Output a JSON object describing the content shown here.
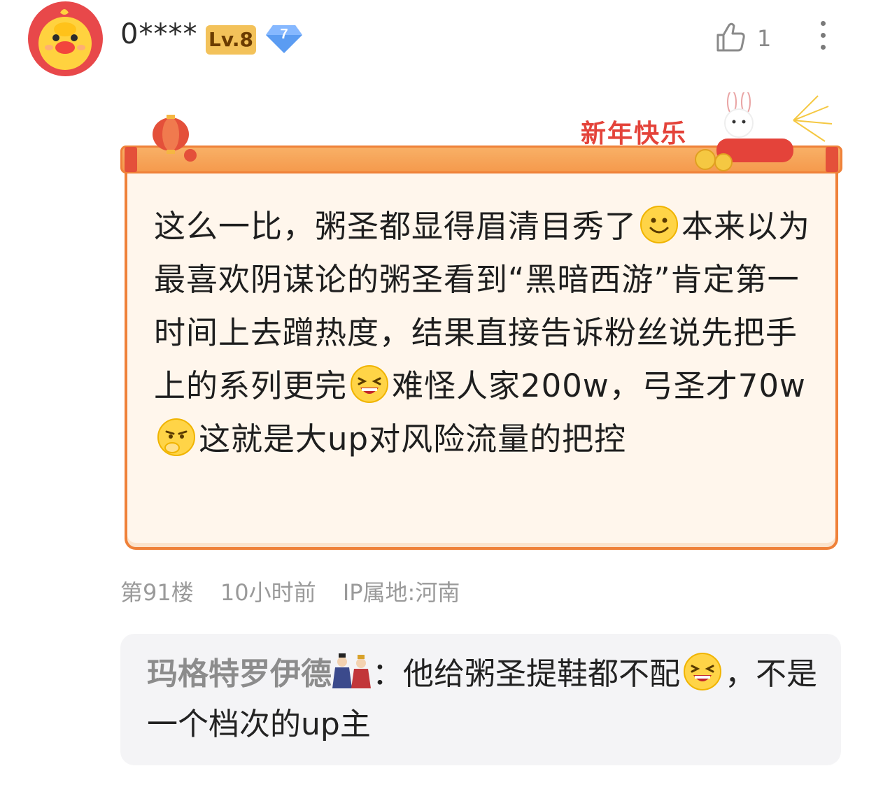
{
  "user": {
    "name": "0****",
    "level_badge": "Lv.8",
    "gem_level": "7"
  },
  "actions": {
    "like_count": "1"
  },
  "card": {
    "banner_text": "新年快乐",
    "text_1": "这么一比，粥圣都显得眉清目秀了",
    "text_2": "本来以为最喜欢阴谋论的粥圣看到“黑暗西游”肯定第一时间上去蹭热度，结果直接告诉粉丝说先把手上的系列更完",
    "text_3": "难怪人家200w，弓圣才70w",
    "text_4": "这就是大up对风险流量的把控"
  },
  "meta": {
    "floor": "第91楼",
    "time": "10小时前",
    "ip": "IP属地:河南"
  },
  "reply": {
    "author": "玛格特罗伊德",
    "separator": "：",
    "text_1": "他给粥圣提鞋都不配",
    "text_2": "，不是一个档次的up主"
  },
  "icons": {
    "avatar": "duck-avatar",
    "gem": "diamond-icon",
    "like": "thumbs-up-icon",
    "more": "more-vertical-icon",
    "emoji_smile": "smile-emoji",
    "emoji_laugh": "laugh-emoji",
    "emoji_think": "think-emoji",
    "figures": "doll-figures-emoji"
  },
  "colors": {
    "accent": "#ef8139",
    "banner": "#e4433a",
    "level_badge": "#f3c25a",
    "gem": "#5b9cf2"
  }
}
